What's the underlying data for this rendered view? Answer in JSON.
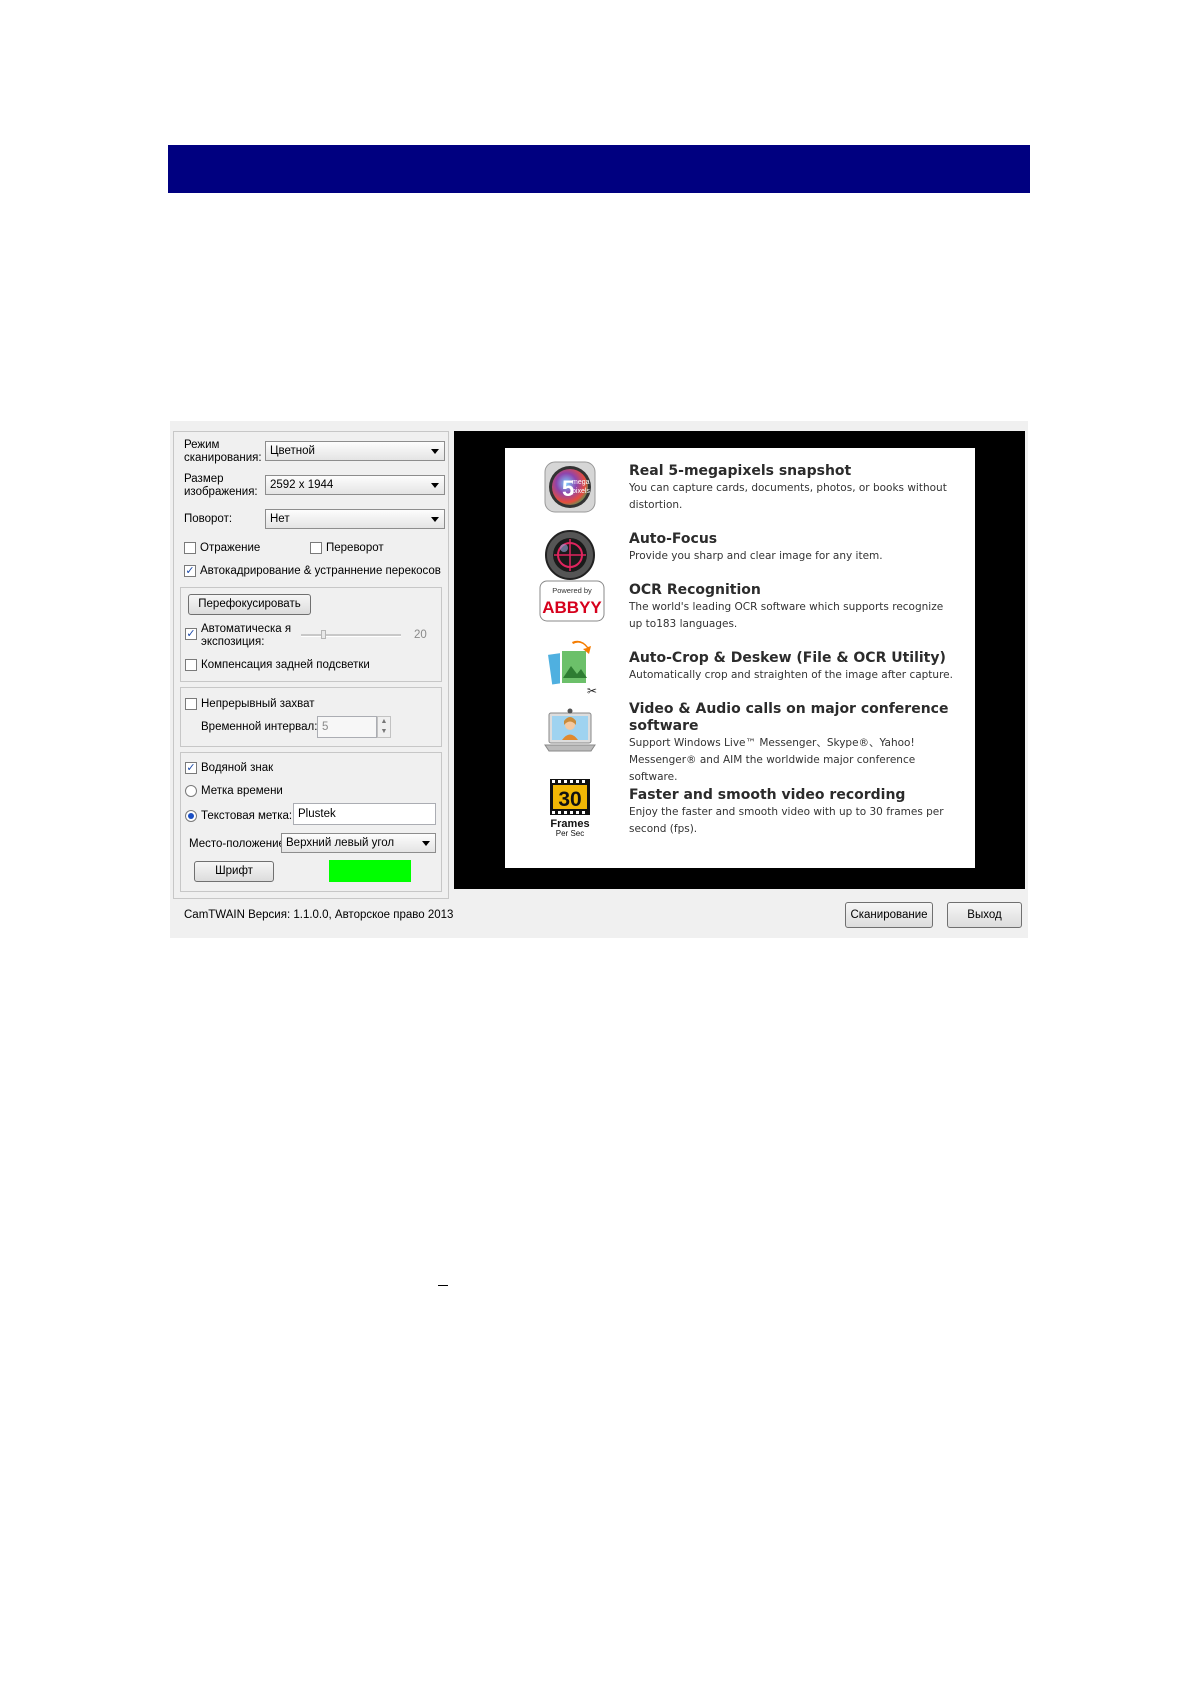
{
  "settings": {
    "scan_mode_label": "Режим сканирования:",
    "scan_mode_value": "Цветной",
    "image_size_label": "Размер изображения:",
    "image_size_value": "2592 x 1944",
    "rotation_label": "Поворот:",
    "rotation_value": "Нет",
    "mirror_label": "Отражение",
    "mirror_checked": false,
    "flip_label": "Переворот",
    "flip_checked": false,
    "autocrop_label": "Автокадрирование & устраннение перекосов",
    "autocrop_checked": true,
    "refocus_button": "Перефокусировать",
    "auto_exposure_label": "Автоматическа я экспозиция:",
    "auto_exposure_checked": true,
    "exposure_value": "20",
    "backlight_label": "Компенсация задней подсветки",
    "backlight_checked": false,
    "continuous_label": "Непрерывный захват",
    "continuous_checked": false,
    "interval_label": "Временной интервал:",
    "interval_value": "5",
    "watermark_label": "Водяной знак",
    "watermark_checked": true,
    "timestamp_label": "Метка времени",
    "timestamp_selected": false,
    "textmark_label": "Текстовая метка:",
    "textmark_selected": true,
    "textmark_value": "Plustek",
    "position_label": "Место-положение:",
    "position_value": "Верхний левый угол",
    "font_button": "Шрифт",
    "watermark_color": "#00ff00"
  },
  "preview": {
    "features": [
      {
        "icon": "megapixel-icon",
        "title": "Real 5-megapixels snapshot",
        "desc": "You can capture cards, documents, photos, or books without distortion."
      },
      {
        "icon": "autofocus-icon",
        "title": "Auto-Focus",
        "desc": "Provide you sharp and clear image for any item."
      },
      {
        "icon": "abbyy-icon",
        "title": "OCR Recognition",
        "desc": "The world's leading OCR software which supports recognize up to183 languages."
      },
      {
        "icon": "autocrop-icon",
        "title": "Auto-Crop & Deskew (File & OCR Utility)",
        "desc": "Automatically crop and straighten of the image after capture."
      },
      {
        "icon": "video-call-icon",
        "title": "Video & Audio calls on major conference software",
        "desc": "Support Windows Live™ Messenger、Skype®、Yahoo! Messenger® and AIM the worldwide major conference software."
      },
      {
        "icon": "fps-icon",
        "title": "Faster and smooth video recording",
        "desc": "Enjoy the faster and smooth video with up to 30 frames per second (fps)."
      }
    ],
    "icon_text": {
      "mp_number": "5",
      "mp_top": "mega",
      "mp_bottom": "pixels",
      "abbyy_top": "Powered by",
      "abbyy_brand": "ABBYY",
      "fps_number": "30",
      "fps_word": "Frames",
      "fps_sub": "Per Sec"
    }
  },
  "footer": {
    "version_text": "CamTWAIN Версия: 1.1.0.0, Авторское право 2013",
    "scan_button": "Сканирование",
    "exit_button": "Выход"
  },
  "colors": {
    "header": "#000080",
    "abbyy_red": "#d6001c"
  }
}
